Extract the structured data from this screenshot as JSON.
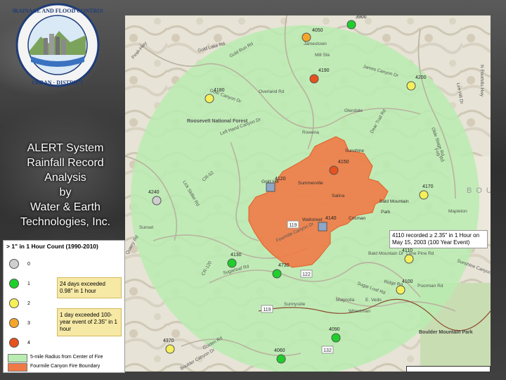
{
  "slide": {
    "title_lines": [
      "ALERT System",
      "Rainfall Record",
      "Analysis",
      "by",
      "Water & Earth",
      "Technologies, Inc."
    ]
  },
  "logo": {
    "text": "URBAN DRAINAGE AND FLOOD CONTROL DISTRICT"
  },
  "colors": {
    "circle_fill": "#b9ecb0",
    "fire_fill": "#f07a46",
    "count_0": "#cfcfcf",
    "count_1": "#1fcf2b",
    "count_2": "#f5f05a",
    "count_3": "#f5a52a",
    "count_4": "#e8501e",
    "note_bg": "#f6e9a6"
  },
  "map": {
    "place_labels": [
      "Jamestown",
      "Roosevelt National Forest",
      "Glendale",
      "Rowena",
      "Gold Hill",
      "Sunshine",
      "Summerville",
      "Salina",
      "Bald Mountain",
      "Crisman",
      "Park",
      "Wallstreet",
      "Sunset",
      "Magnolia",
      "E. Vedo",
      "Wheelman",
      "Sunnyside",
      "Boulder Mountain Park",
      "Left Hand Canyon Dr",
      "Sugarloaf Rd",
      "Fourmile Canyon Dr",
      "Gold Run Rd",
      "Lick Skillet Rd",
      "CR-52",
      "CR-120",
      "Gold Lake Rd",
      "Overland Rd",
      "Peak-Hwy",
      "Mill Ste",
      "Sugar Loaf Rd",
      "Lee Hill Dr",
      "Olde Stage Rd",
      "Sunshine Canyon Dr",
      "Quarry Rd",
      "Boulder Canyon Dr",
      "Golden Rd",
      "Lone Pine Rd",
      "Poorman Rd",
      "James Canyon Dr",
      "Dear Trail Rd",
      "Geer Canyon Dr",
      "Fog Rd",
      "Mapleton",
      "Bald Mountain Dr",
      "Ridge Rd",
      "N Foothills Hwy",
      "BOULDER COLO"
    ],
    "road_shields": [
      "119",
      "122",
      "132",
      "119"
    ],
    "gauges": [
      {
        "id": "3900",
        "count": 1
      },
      {
        "id": "4050",
        "count": 3
      },
      {
        "id": "4190",
        "count": 4
      },
      {
        "id": "4200",
        "count": 2
      },
      {
        "id": "4180",
        "count": 2
      },
      {
        "id": "4150",
        "count": 4
      },
      {
        "id": "4120",
        "count": 0
      },
      {
        "id": "4240",
        "count": 0
      },
      {
        "id": "4170",
        "count": 2
      },
      {
        "id": "4140",
        "count": 0
      },
      {
        "id": "4110",
        "count": 2
      },
      {
        "id": "4130",
        "count": 1
      },
      {
        "id": "4730",
        "count": 1
      },
      {
        "id": "4100",
        "count": 2
      },
      {
        "id": "4090",
        "count": 1
      },
      {
        "id": "4370",
        "count": 2
      },
      {
        "id": "4060",
        "count": 1
      }
    ]
  },
  "callout": {
    "text": "4110 recorded ≥ 2.35\" in 1 Hour on May 15, 2003 (100 Year Event)"
  },
  "legend": {
    "title": "> 1\" in 1 Hour Count (1990-2010)",
    "items": [
      {
        "label": "0",
        "color": "#cfcfcf"
      },
      {
        "label": "1",
        "color": "#1fcf2b"
      },
      {
        "label": "2",
        "color": "#f5f05a"
      },
      {
        "label": "3",
        "color": "#f5a52a"
      },
      {
        "label": "4",
        "color": "#e8501e"
      }
    ],
    "note_1": "24 days exceeded 0.98\" in 1 hour",
    "note_2": "1 day exceeded 100-year event of 2.35\" in 1 hour",
    "radius_label": "5-mile Radius from Center of Fire",
    "fire_label": "Fourmile Canyon Fire Boundary"
  }
}
